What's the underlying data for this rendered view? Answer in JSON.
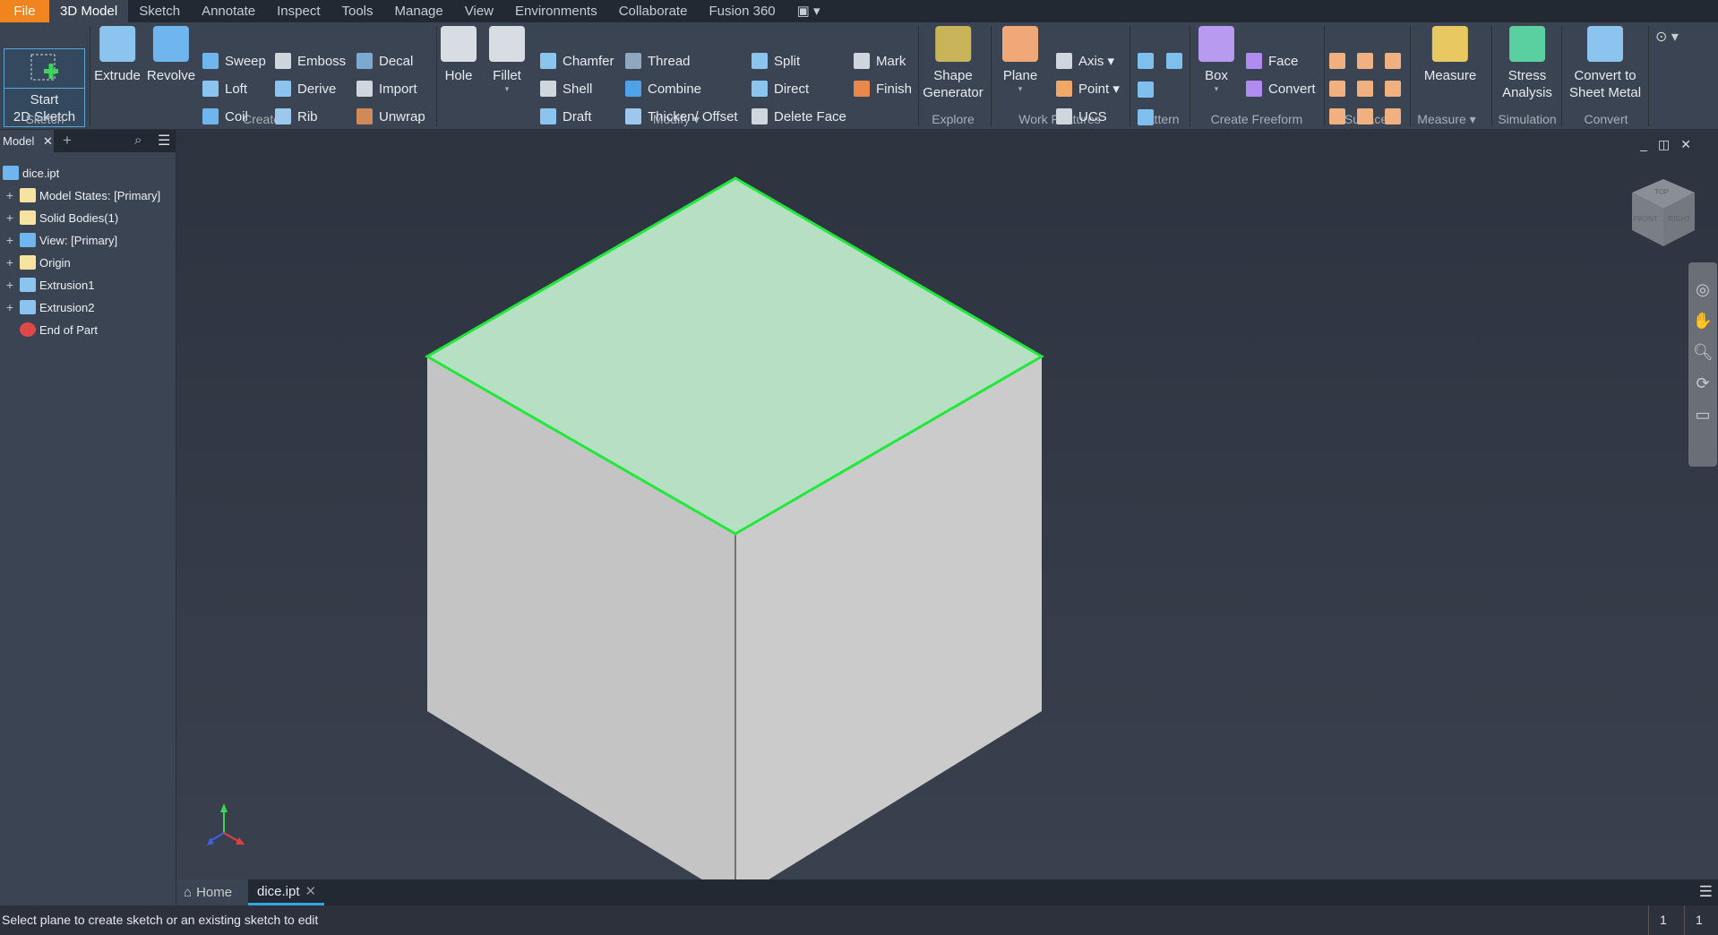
{
  "menu": {
    "tabs": [
      "File",
      "3D Model",
      "Sketch",
      "Annotate",
      "Inspect",
      "Tools",
      "Manage",
      "View",
      "Environments",
      "Collaborate",
      "Fusion 360"
    ],
    "active": "3D Model"
  },
  "ribbon": {
    "start_sketch": {
      "line1": "Start",
      "line2": "2D Sketch"
    },
    "panels": [
      "Sketch",
      "Create",
      "Modify ▾",
      "Explore",
      "Work Features",
      "Pattern",
      "Create Freeform",
      "Surface",
      "Measure ▾",
      "Simulation",
      "Convert"
    ],
    "small_items": [
      {
        "label": "Sweep",
        "icon": "sweep-icon",
        "color": "#6fb6ee"
      },
      {
        "label": "Loft",
        "icon": "loft-icon",
        "color": "#8cc4f0"
      },
      {
        "label": "Coil",
        "icon": "coil-icon",
        "color": "#6fb6ee"
      },
      {
        "label": "Emboss",
        "icon": "emboss-icon",
        "color": "#cfd6de"
      },
      {
        "label": "Derive",
        "icon": "derive-icon",
        "color": "#8cc4f0"
      },
      {
        "label": "Rib",
        "icon": "rib-icon",
        "color": "#9cc8ee"
      },
      {
        "label": "Decal",
        "icon": "decal-icon",
        "color": "#7fa8d0"
      },
      {
        "label": "Import",
        "icon": "import-icon",
        "color": "#cfd6de"
      },
      {
        "label": "Unwrap",
        "icon": "unwrap-icon",
        "color": "#d08a5a"
      },
      {
        "label": "Chamfer",
        "icon": "chamfer-icon",
        "color": "#8cc4f0"
      },
      {
        "label": "Shell",
        "icon": "shell-icon",
        "color": "#cfd6de"
      },
      {
        "label": "Draft",
        "icon": "draft-icon",
        "color": "#8cc4f0"
      },
      {
        "label": "Thread",
        "icon": "thread-icon",
        "color": "#8fa8c0"
      },
      {
        "label": "Combine",
        "icon": "combine-icon",
        "color": "#4fa2e8"
      },
      {
        "label": "Thicken/ Offset",
        "icon": "thicken-icon",
        "color": "#9cc8ee"
      },
      {
        "label": "Split",
        "icon": "split-icon",
        "color": "#8cc4f0"
      },
      {
        "label": "Direct",
        "icon": "direct-icon",
        "color": "#8cc4f0"
      },
      {
        "label": "Delete Face",
        "icon": "delete-face-icon",
        "color": "#cfd6de"
      },
      {
        "label": "Mark",
        "icon": "mark-icon",
        "color": "#cfd6de"
      },
      {
        "label": "Finish",
        "icon": "finish-icon",
        "color": "#e8884a"
      },
      {
        "label": "Axis ▾",
        "icon": "axis-icon",
        "color": "#cfd6de"
      },
      {
        "label": "Point ▾",
        "icon": "point-icon",
        "color": "#f0a868"
      },
      {
        "label": "UCS",
        "icon": "ucs-icon",
        "color": "#cfd6de"
      },
      {
        "label": "Face",
        "icon": "face-icon",
        "color": "#b08cf0"
      },
      {
        "label": "Convert",
        "icon": "convert-freeform-icon",
        "color": "#b08cf0"
      }
    ],
    "big_items": [
      {
        "label": "Extrude",
        "icon": "extrude-icon",
        "color": "#8cc4f0",
        "caret": false
      },
      {
        "label": "Revolve",
        "icon": "revolve-icon",
        "color": "#6fb6ee",
        "caret": false
      },
      {
        "label": "Hole",
        "icon": "hole-icon",
        "color": "#d8dde3",
        "caret": false
      },
      {
        "label": "Fillet",
        "icon": "fillet-icon",
        "color": "#d8dde3",
        "caret": true
      },
      {
        "label": "Shape\nGenerator",
        "icon": "shape-generator-icon",
        "color": "#c9b45a",
        "caret": false
      },
      {
        "label": "Plane",
        "icon": "plane-icon",
        "color": "#f0a878",
        "caret": true
      },
      {
        "label": "Box",
        "icon": "box-icon",
        "color": "#b89af0",
        "caret": true
      },
      {
        "label": "Measure",
        "icon": "measure-icon",
        "color": "#e8c860",
        "caret": false
      },
      {
        "label": "Stress\nAnalysis",
        "icon": "stress-analysis-icon",
        "color": "#5ad0a0",
        "caret": false
      },
      {
        "label": "Convert to\nSheet Metal",
        "icon": "sheet-metal-icon",
        "color": "#8cc4f0",
        "caret": false
      }
    ],
    "pattern_icons": [
      "rectangular-pattern-icon",
      "mirror-icon",
      "circular-pattern-icon",
      "sketch-driven-pattern-icon"
    ],
    "surface_icons": [
      "stitch-icon",
      "patch-icon",
      "sculpt-icon",
      "boundary-patch-icon",
      "trim-icon",
      "delete-surface-icon",
      "ruled-surface-icon",
      "extend-icon",
      "replace-face-icon"
    ]
  },
  "browser": {
    "tab": "Model",
    "root": "dice.ipt",
    "items": [
      {
        "label": "Model States: [Primary]",
        "icon": "folder-icon"
      },
      {
        "label": "Solid Bodies(1)",
        "icon": "solid-bodies-folder-icon"
      },
      {
        "label": "View: [Primary]",
        "icon": "view-rep-icon"
      },
      {
        "label": "Origin",
        "icon": "folder-icon"
      },
      {
        "label": "Extrusion1",
        "icon": "extrusion-icon"
      },
      {
        "label": "Extrusion2",
        "icon": "extrusion-icon"
      },
      {
        "label": "End of Part",
        "icon": "end-of-part-icon"
      }
    ]
  },
  "viewcube": {
    "top": "TOP",
    "front": "FRONT",
    "right": "RIGHT"
  },
  "model": {
    "top_color": "#b6dfc4",
    "left_color": "#c4c4c4",
    "right_color": "#cbcbcb",
    "highlight": "#22e83c"
  },
  "doc_tabs": {
    "home": "Home",
    "active": "dice.ipt"
  },
  "status": {
    "message": "Select plane to create sketch or an existing sketch to edit",
    "count1": "1",
    "count2": "1"
  },
  "colors": {
    "file_tab": "#f0841f",
    "accent": "#2fa8e0"
  }
}
